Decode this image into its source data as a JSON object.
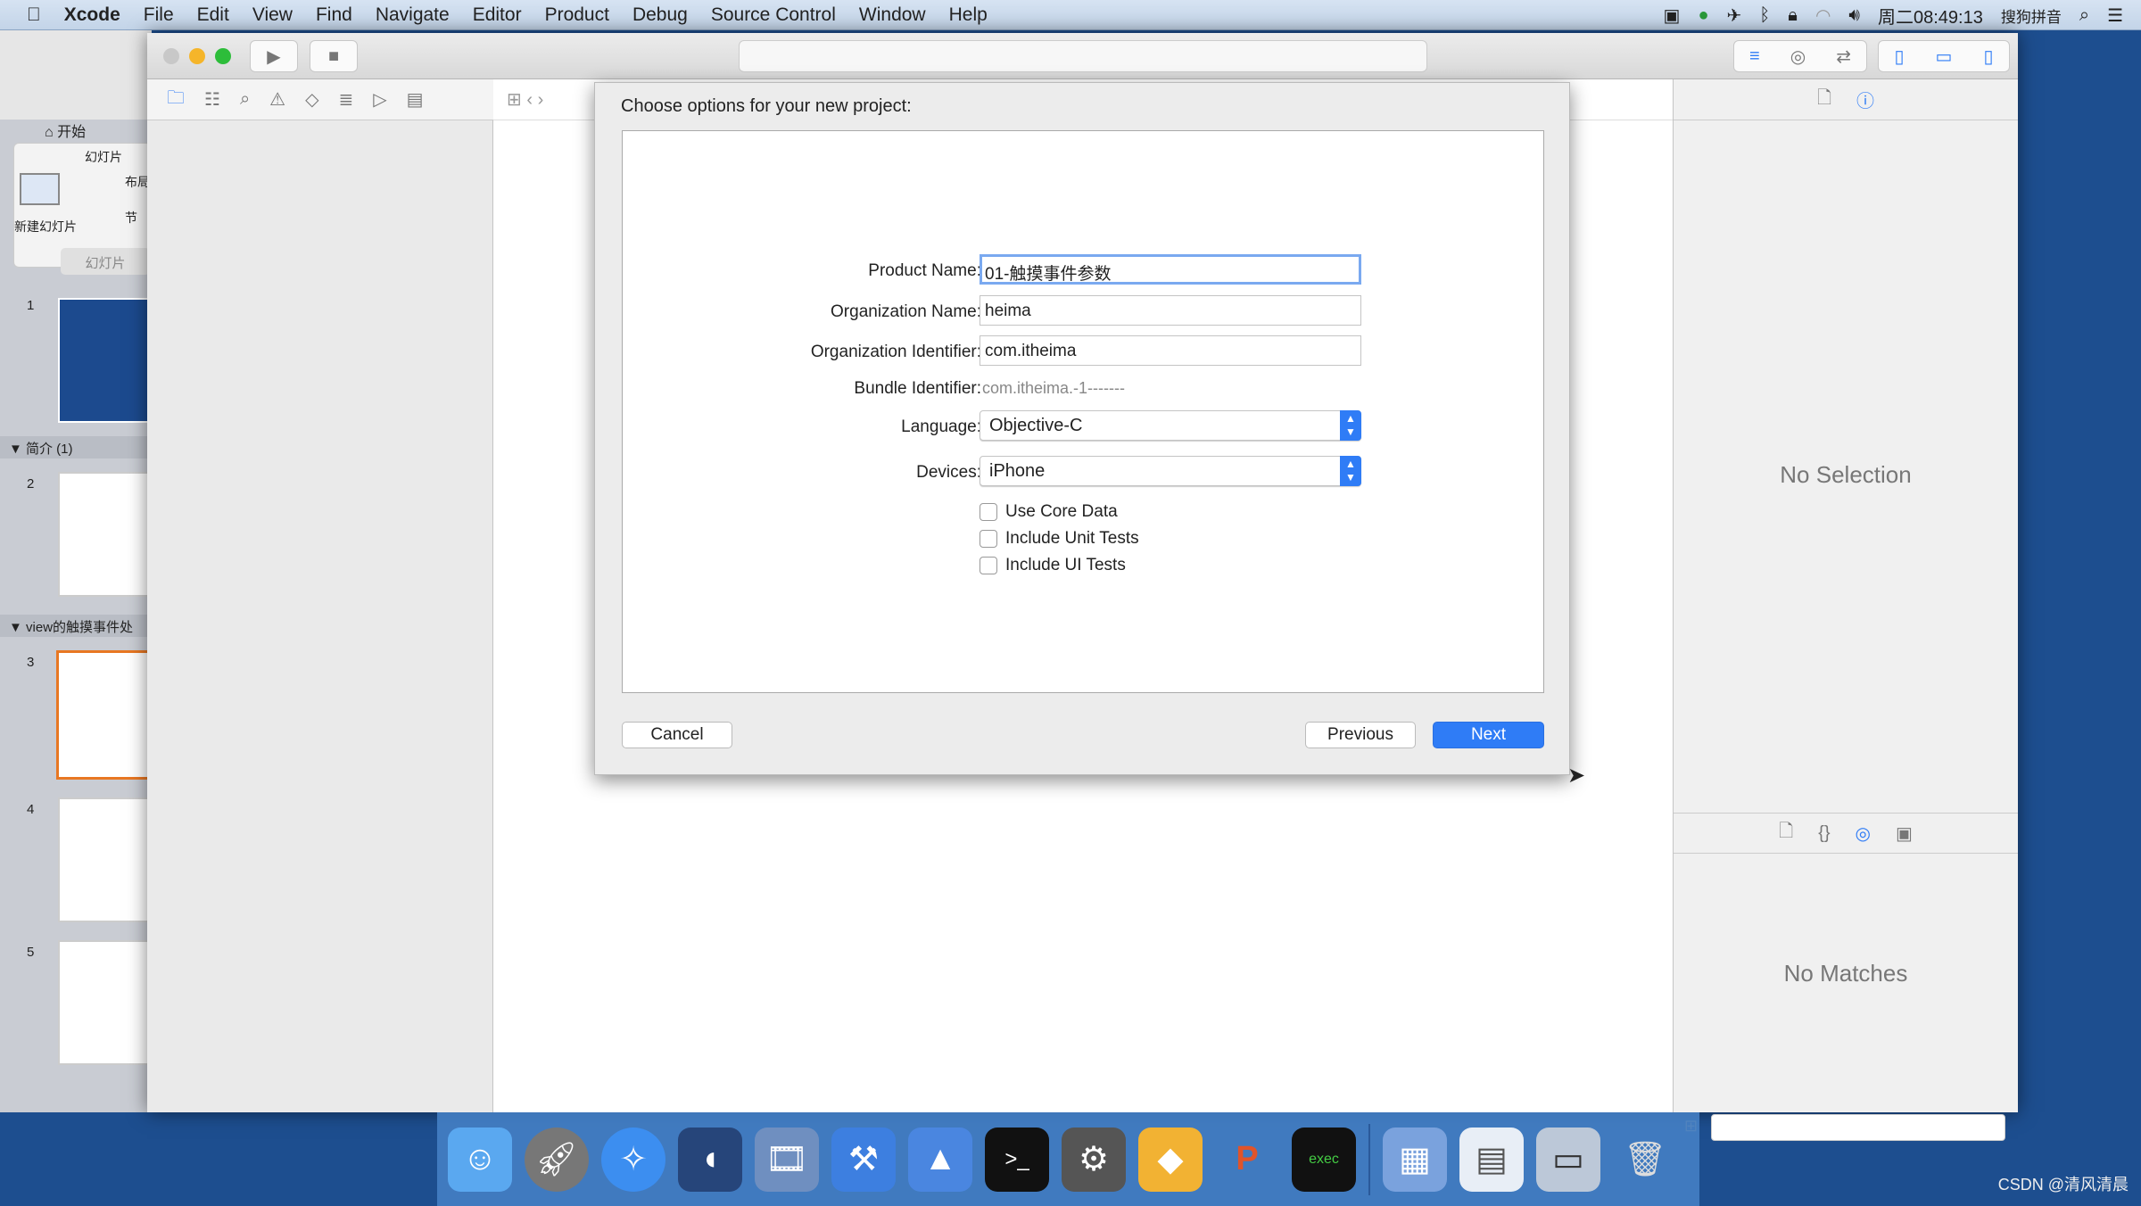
{
  "menubar": {
    "apple": "",
    "app": "Xcode",
    "items": [
      "File",
      "Edit",
      "View",
      "Find",
      "Navigate",
      "Editor",
      "Product",
      "Debug",
      "Source Control",
      "Window",
      "Help"
    ],
    "clock": "周二08:49:13",
    "ime": "搜狗拼音"
  },
  "ppt": {
    "tab_home": "开始",
    "group_label": "幻灯片",
    "new_slide": "新建幻灯片",
    "layout": "布局",
    "section": "节",
    "panel_tab": "幻灯片",
    "sections": [
      "简介 (1)",
      "view的触摸事件处"
    ],
    "slide_numbers": [
      "1",
      "2",
      "3",
      "4",
      "5"
    ]
  },
  "sheet": {
    "title": "Choose options for your new project:",
    "product_name_label": "Product Name:",
    "product_name": "01-触摸事件参数",
    "org_name_label": "Organization Name:",
    "org_name": "heima",
    "org_id_label": "Organization Identifier:",
    "org_id": "com.itheima",
    "bundle_label": "Bundle Identifier:",
    "bundle": "com.itheima.-1-------",
    "language_label": "Language:",
    "language": "Objective-C",
    "devices_label": "Devices:",
    "devices": "iPhone",
    "checkboxes": [
      {
        "label": "Use Core Data",
        "checked": false
      },
      {
        "label": "Include Unit Tests",
        "checked": false
      },
      {
        "label": "Include UI Tests",
        "checked": false
      }
    ],
    "cancel": "Cancel",
    "previous": "Previous",
    "next": "Next"
  },
  "inspector": {
    "no_selection": "No Selection",
    "no_matches": "No Matches"
  },
  "dock": {
    "apps": [
      "finder",
      "launchpad",
      "safari",
      "mouse",
      "photo-booth",
      "xcode",
      "instruments",
      "terminal",
      "system-preferences",
      "sketch",
      "powerpoint",
      "exec"
    ],
    "stacks": [
      "downloads",
      "documents",
      "screens",
      "trash"
    ]
  },
  "watermark": "CSDN @清风清晨",
  "colors": {
    "accent": "#2f7cf6",
    "menubar": "#c9d9ec",
    "desktop": "#1d4e8f"
  }
}
